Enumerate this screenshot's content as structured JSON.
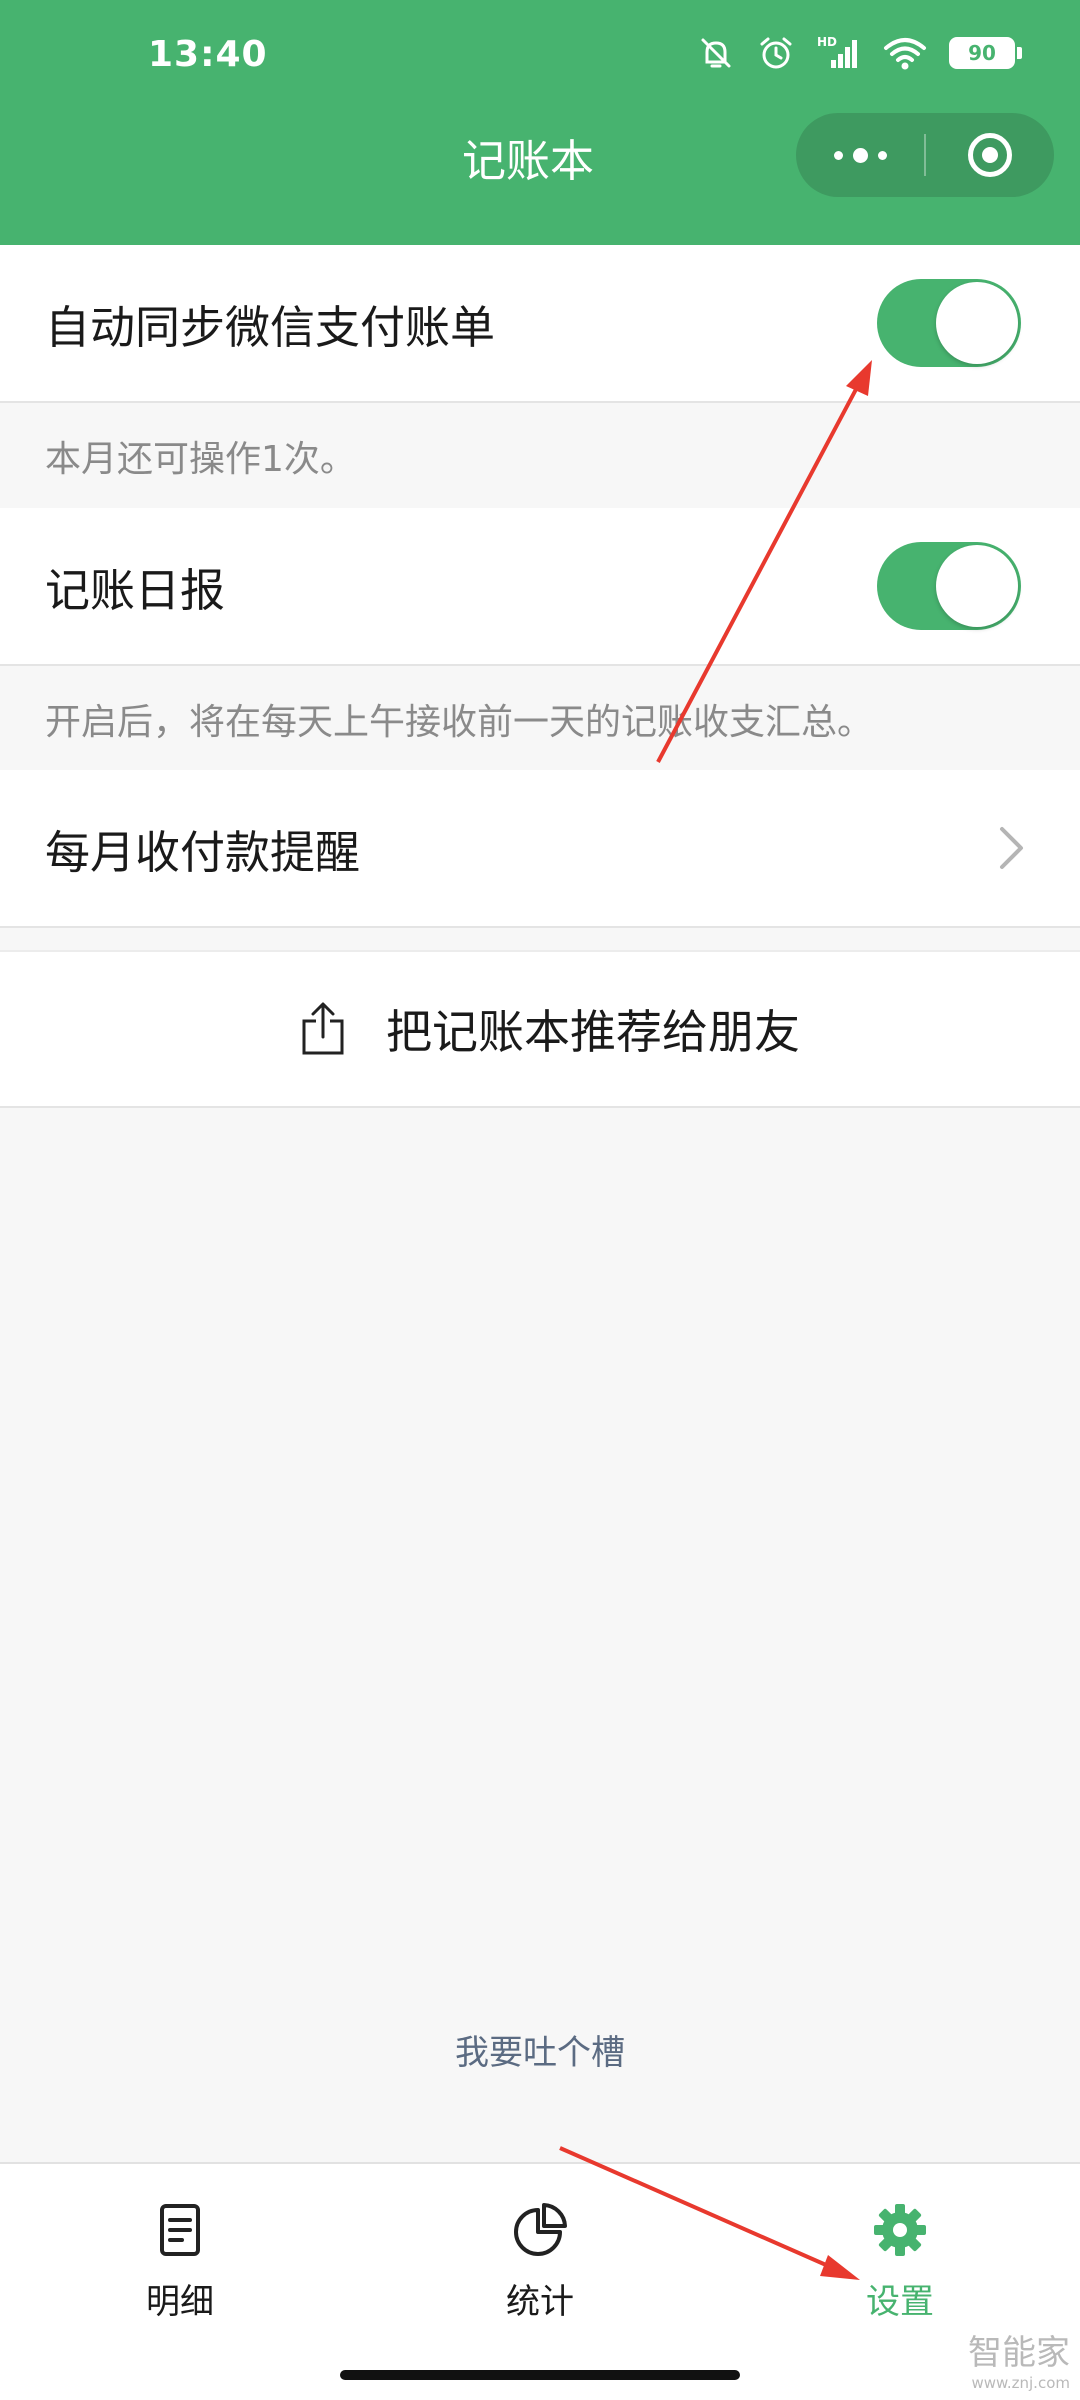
{
  "status_bar": {
    "time": "13:40",
    "battery_level": "90"
  },
  "nav": {
    "title": "记账本"
  },
  "settings": [
    {
      "label": "自动同步微信支付账单",
      "toggle_on": true,
      "hint": "本月还可操作1次。"
    },
    {
      "label": "记账日报",
      "toggle_on": true,
      "hint": "开启后，将在每天上午接收前一天的记账收支汇总。"
    },
    {
      "label": "每月收付款提醒"
    }
  ],
  "share": {
    "label": "把记账本推荐给朋友"
  },
  "feedback": {
    "label": "我要吐个槽"
  },
  "tabs": [
    {
      "label": "明细",
      "icon": "document-icon",
      "active": false
    },
    {
      "label": "统计",
      "icon": "pie-chart-icon",
      "active": false
    },
    {
      "label": "设置",
      "icon": "gear-icon",
      "active": true
    }
  ],
  "watermark": {
    "main": "智能家",
    "sub": "www.znj.com"
  },
  "colors": {
    "brand": "#47b36f",
    "annotation": "#e8392e"
  }
}
